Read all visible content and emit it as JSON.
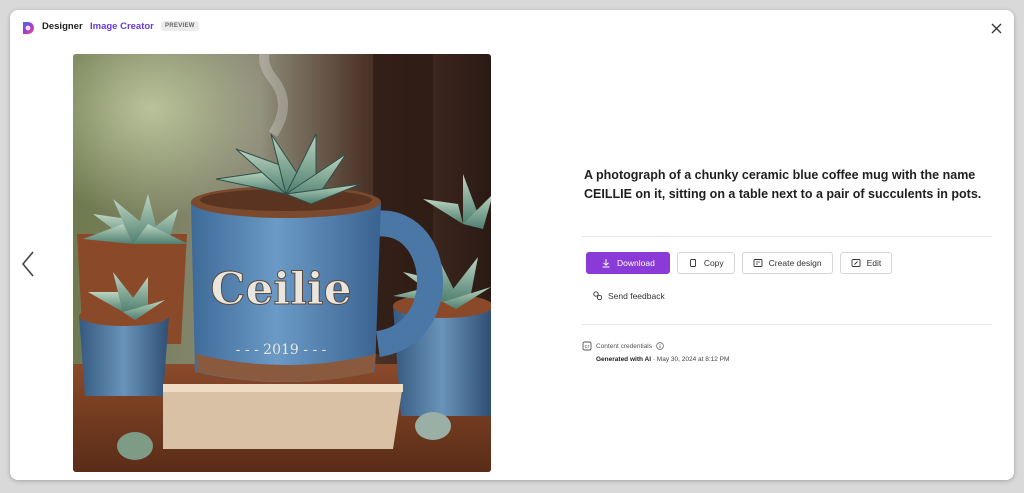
{
  "header": {
    "brand": "Designer",
    "product": "Image Creator",
    "badge": "PREVIEW"
  },
  "image": {
    "mug_text": "Ceilie",
    "mug_year": "- - - 2019 - - -"
  },
  "prompt": "A photograph of a chunky ceramic blue coffee mug with the name CEILLIE on it, sitting on a table next to a pair of succulents in pots.",
  "actions": {
    "download": "Download",
    "copy": "Copy",
    "create_design": "Create design",
    "edit": "Edit"
  },
  "feedback_label": "Send feedback",
  "credentials": {
    "label": "Content credentials",
    "generated_label": "Generated with AI",
    "date": " · May 30, 2024 at 8:12 PM"
  },
  "colors": {
    "accent": "#8a3ad6",
    "product_text": "#6b3bd6",
    "mug_blue": "#4f7fb0"
  },
  "icons": [
    "app-logo-icon",
    "close-icon",
    "chevron-left-icon",
    "download-icon",
    "copy-icon",
    "create-design-icon",
    "edit-icon",
    "feedback-icon",
    "content-credentials-icon",
    "info-icon"
  ]
}
